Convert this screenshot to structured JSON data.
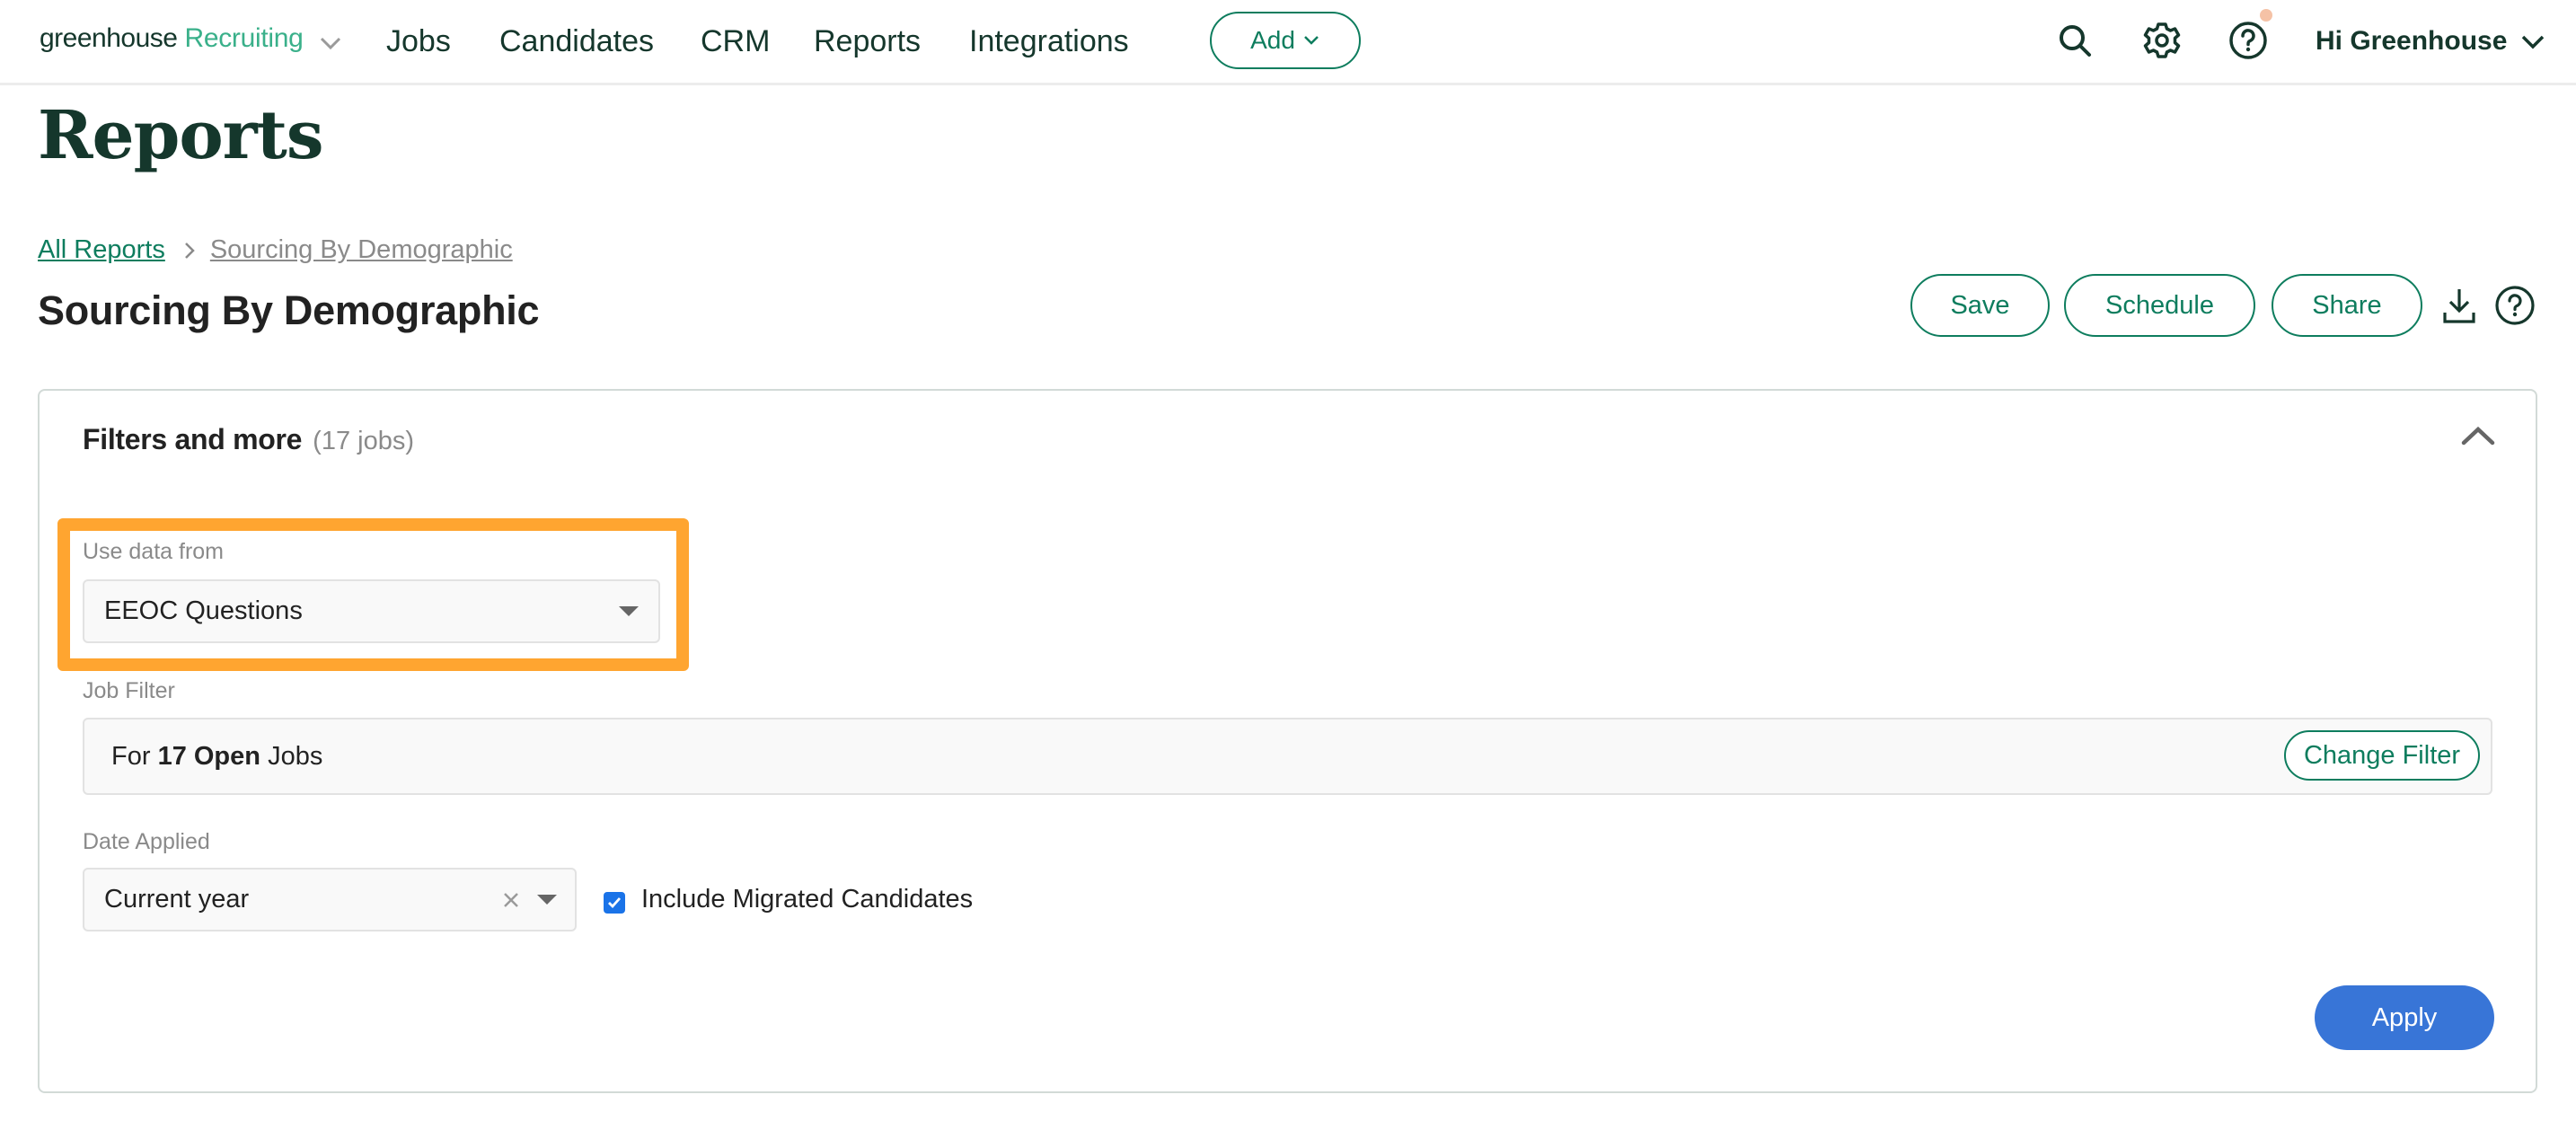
{
  "nav": {
    "logo_primary": "greenhouse",
    "logo_secondary": "Recruiting",
    "items": [
      {
        "label": "Jobs"
      },
      {
        "label": "Candidates"
      },
      {
        "label": "CRM"
      },
      {
        "label": "Reports"
      },
      {
        "label": "Integrations"
      }
    ],
    "add_label": "Add",
    "icons": [
      "search-icon",
      "gear-icon",
      "help-icon"
    ],
    "user_greeting": "Hi Greenhouse"
  },
  "page": {
    "title": "Reports",
    "breadcrumb": [
      {
        "label": "All Reports"
      },
      {
        "label": "Sourcing By Demographic"
      }
    ],
    "report_title": "Sourcing By Demographic",
    "actions": {
      "save": "Save",
      "schedule": "Schedule",
      "share": "Share"
    }
  },
  "filters": {
    "title": "Filters and more",
    "count": "(17 jobs)",
    "use_data_from": {
      "label": "Use data from",
      "value": "EEOC Questions"
    },
    "job_filter": {
      "label": "Job Filter",
      "prefix": "For",
      "count_status": "17 Open",
      "suffix": "Jobs",
      "change_label": "Change Filter"
    },
    "date_applied": {
      "label": "Date Applied",
      "value": "Current year"
    },
    "include_migrated": {
      "label": "Include Migrated Candidates",
      "checked": true
    },
    "apply_label": "Apply"
  },
  "colors": {
    "brand_green": "#0e7d5e",
    "logo_accent": "#3ab08a",
    "highlight_orange": "#ffa530",
    "apply_blue": "#3875d7",
    "checkbox_blue": "#1a73e8",
    "notification_dot": "#f5c2a6"
  }
}
